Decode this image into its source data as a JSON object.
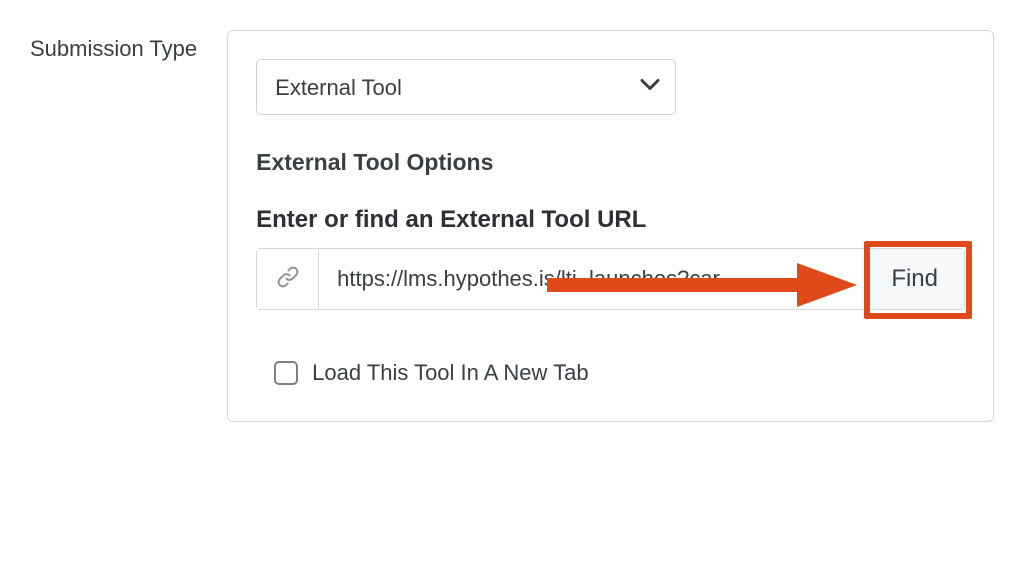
{
  "label": "Submission Type",
  "submission_type": {
    "selected_label": "External Tool"
  },
  "options": {
    "section_title": "External Tool Options",
    "url_label": "Enter or find an External Tool URL",
    "url_value": "https://lms.hypothes.is/lti_launches?car",
    "find_label": "Find",
    "checkbox_label": "Load This Tool In A New Tab"
  },
  "annotation": {
    "highlight_color": "#e04a1a"
  }
}
